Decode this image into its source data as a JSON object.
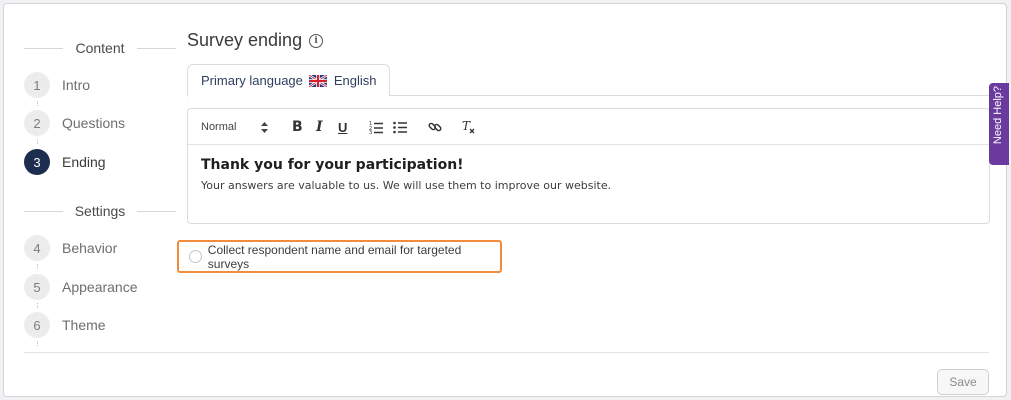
{
  "nav": {
    "content_header": "Content",
    "settings_header": "Settings",
    "steps": [
      {
        "num": "1",
        "label": "Intro"
      },
      {
        "num": "2",
        "label": "Questions"
      },
      {
        "num": "3",
        "label": "Ending"
      },
      {
        "num": "4",
        "label": "Behavior"
      },
      {
        "num": "5",
        "label": "Appearance"
      },
      {
        "num": "6",
        "label": "Theme"
      }
    ],
    "active_step": "3"
  },
  "main": {
    "title": "Survey ending",
    "info_icon": "i",
    "tab": {
      "prefix": "Primary language",
      "language": "English",
      "flag": "uk-flag-icon"
    },
    "toolbar": {
      "format": "Normal",
      "bold": "B",
      "italic": "I",
      "underline": "U",
      "clear": "Tx"
    },
    "editor": {
      "heading": "Thank you for your participation!",
      "body": "Your answers are valuable to us. We will use them to improve our website."
    },
    "collect_label": "Collect respondent name and email for targeted surveys",
    "save_label": "Save"
  },
  "help_label": "Need Help?",
  "colors": {
    "accent": "#1d2d4f",
    "highlight": "#f28c3d",
    "help": "#6a3a9e"
  }
}
